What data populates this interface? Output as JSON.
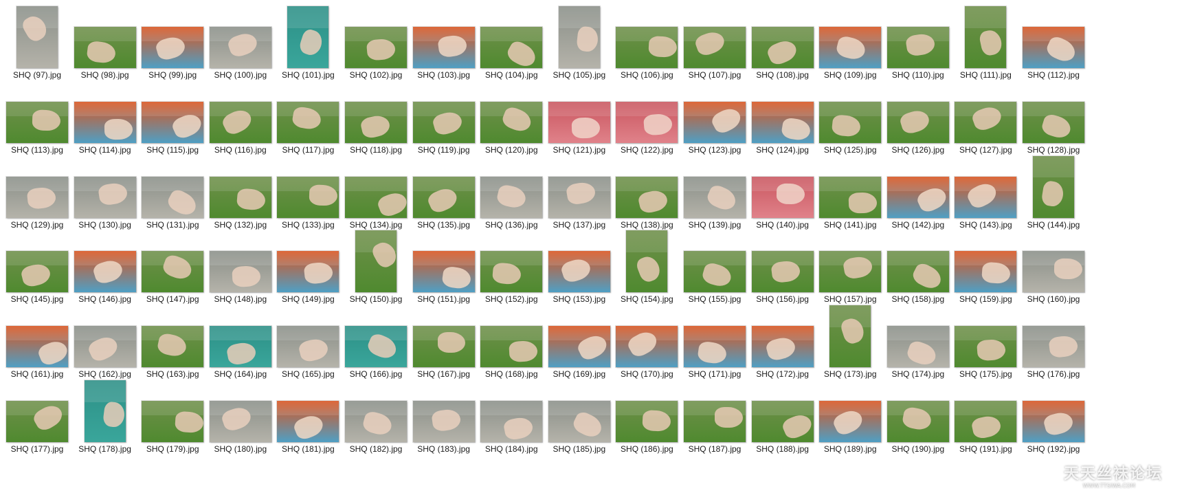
{
  "files": [
    {
      "name": "SHQ (97).jpg",
      "orientation": "portrait",
      "scene": "stone"
    },
    {
      "name": "SHQ (98).jpg",
      "orientation": "landscape",
      "scene": "grass"
    },
    {
      "name": "SHQ (99).jpg",
      "orientation": "landscape",
      "scene": "playground"
    },
    {
      "name": "SHQ (100).jpg",
      "orientation": "landscape",
      "scene": "stone"
    },
    {
      "name": "SHQ (101).jpg",
      "orientation": "portrait",
      "scene": "slide"
    },
    {
      "name": "SHQ (102).jpg",
      "orientation": "landscape",
      "scene": "grass"
    },
    {
      "name": "SHQ (103).jpg",
      "orientation": "landscape",
      "scene": "playground"
    },
    {
      "name": "SHQ (104).jpg",
      "orientation": "landscape",
      "scene": "grass"
    },
    {
      "name": "SHQ (105).jpg",
      "orientation": "portrait",
      "scene": "stone"
    },
    {
      "name": "SHQ (106).jpg",
      "orientation": "landscape",
      "scene": "grass"
    },
    {
      "name": "SHQ (107).jpg",
      "orientation": "landscape",
      "scene": "grass"
    },
    {
      "name": "SHQ (108).jpg",
      "orientation": "landscape",
      "scene": "grass"
    },
    {
      "name": "SHQ (109).jpg",
      "orientation": "landscape",
      "scene": "playground"
    },
    {
      "name": "SHQ (110).jpg",
      "orientation": "landscape",
      "scene": "grass"
    },
    {
      "name": "SHQ (111).jpg",
      "orientation": "portrait",
      "scene": "grass"
    },
    {
      "name": "SHQ (112).jpg",
      "orientation": "landscape",
      "scene": "playground"
    },
    {
      "name": "SHQ (113).jpg",
      "orientation": "landscape",
      "scene": "grass"
    },
    {
      "name": "SHQ (114).jpg",
      "orientation": "landscape",
      "scene": "playground"
    },
    {
      "name": "SHQ (115).jpg",
      "orientation": "landscape",
      "scene": "playground"
    },
    {
      "name": "SHQ (116).jpg",
      "orientation": "landscape",
      "scene": "grass"
    },
    {
      "name": "SHQ (117).jpg",
      "orientation": "landscape",
      "scene": "grass"
    },
    {
      "name": "SHQ (118).jpg",
      "orientation": "landscape",
      "scene": "grass"
    },
    {
      "name": "SHQ (119).jpg",
      "orientation": "landscape",
      "scene": "grass"
    },
    {
      "name": "SHQ (120).jpg",
      "orientation": "landscape",
      "scene": "grass"
    },
    {
      "name": "SHQ (121).jpg",
      "orientation": "landscape",
      "scene": "pinkslide"
    },
    {
      "name": "SHQ (122).jpg",
      "orientation": "landscape",
      "scene": "pinkslide"
    },
    {
      "name": "SHQ (123).jpg",
      "orientation": "landscape",
      "scene": "playground"
    },
    {
      "name": "SHQ (124).jpg",
      "orientation": "landscape",
      "scene": "playground"
    },
    {
      "name": "SHQ (125).jpg",
      "orientation": "landscape",
      "scene": "grass"
    },
    {
      "name": "SHQ (126).jpg",
      "orientation": "landscape",
      "scene": "grass"
    },
    {
      "name": "SHQ (127).jpg",
      "orientation": "landscape",
      "scene": "grass"
    },
    {
      "name": "SHQ (128).jpg",
      "orientation": "landscape",
      "scene": "grass"
    },
    {
      "name": "SHQ (129).jpg",
      "orientation": "landscape",
      "scene": "stone"
    },
    {
      "name": "SHQ (130).jpg",
      "orientation": "landscape",
      "scene": "stone"
    },
    {
      "name": "SHQ (131).jpg",
      "orientation": "landscape",
      "scene": "stone"
    },
    {
      "name": "SHQ (132).jpg",
      "orientation": "landscape",
      "scene": "grass"
    },
    {
      "name": "SHQ (133).jpg",
      "orientation": "landscape",
      "scene": "grass"
    },
    {
      "name": "SHQ (134).jpg",
      "orientation": "landscape",
      "scene": "grass"
    },
    {
      "name": "SHQ (135).jpg",
      "orientation": "landscape",
      "scene": "grass"
    },
    {
      "name": "SHQ (136).jpg",
      "orientation": "landscape",
      "scene": "stone"
    },
    {
      "name": "SHQ (137).jpg",
      "orientation": "landscape",
      "scene": "stone"
    },
    {
      "name": "SHQ (138).jpg",
      "orientation": "landscape",
      "scene": "grass"
    },
    {
      "name": "SHQ (139).jpg",
      "orientation": "landscape",
      "scene": "stone"
    },
    {
      "name": "SHQ (140).jpg",
      "orientation": "landscape",
      "scene": "pinkslide"
    },
    {
      "name": "SHQ (141).jpg",
      "orientation": "landscape",
      "scene": "grass"
    },
    {
      "name": "SHQ (142).jpg",
      "orientation": "landscape",
      "scene": "playground"
    },
    {
      "name": "SHQ (143).jpg",
      "orientation": "landscape",
      "scene": "playground"
    },
    {
      "name": "SHQ (144).jpg",
      "orientation": "portrait",
      "scene": "grass"
    },
    {
      "name": "SHQ (145).jpg",
      "orientation": "landscape",
      "scene": "grass"
    },
    {
      "name": "SHQ (146).jpg",
      "orientation": "landscape",
      "scene": "playground"
    },
    {
      "name": "SHQ (147).jpg",
      "orientation": "landscape",
      "scene": "grass"
    },
    {
      "name": "SHQ (148).jpg",
      "orientation": "landscape",
      "scene": "stone"
    },
    {
      "name": "SHQ (149).jpg",
      "orientation": "landscape",
      "scene": "playground"
    },
    {
      "name": "SHQ (150).jpg",
      "orientation": "portrait",
      "scene": "grass"
    },
    {
      "name": "SHQ (151).jpg",
      "orientation": "landscape",
      "scene": "playground"
    },
    {
      "name": "SHQ (152).jpg",
      "orientation": "landscape",
      "scene": "grass"
    },
    {
      "name": "SHQ (153).jpg",
      "orientation": "landscape",
      "scene": "playground"
    },
    {
      "name": "SHQ (154).jpg",
      "orientation": "portrait",
      "scene": "grass"
    },
    {
      "name": "SHQ (155).jpg",
      "orientation": "landscape",
      "scene": "grass"
    },
    {
      "name": "SHQ (156).jpg",
      "orientation": "landscape",
      "scene": "grass"
    },
    {
      "name": "SHQ (157).jpg",
      "orientation": "landscape",
      "scene": "grass"
    },
    {
      "name": "SHQ (158).jpg",
      "orientation": "landscape",
      "scene": "grass"
    },
    {
      "name": "SHQ (159).jpg",
      "orientation": "landscape",
      "scene": "playground"
    },
    {
      "name": "SHQ (160).jpg",
      "orientation": "landscape",
      "scene": "stone"
    },
    {
      "name": "SHQ (161).jpg",
      "orientation": "landscape",
      "scene": "playground"
    },
    {
      "name": "SHQ (162).jpg",
      "orientation": "landscape",
      "scene": "stone"
    },
    {
      "name": "SHQ (163).jpg",
      "orientation": "landscape",
      "scene": "grass"
    },
    {
      "name": "SHQ (164).jpg",
      "orientation": "landscape",
      "scene": "slide"
    },
    {
      "name": "SHQ (165).jpg",
      "orientation": "landscape",
      "scene": "stone"
    },
    {
      "name": "SHQ (166).jpg",
      "orientation": "landscape",
      "scene": "slide"
    },
    {
      "name": "SHQ (167).jpg",
      "orientation": "landscape",
      "scene": "grass"
    },
    {
      "name": "SHQ (168).jpg",
      "orientation": "landscape",
      "scene": "grass"
    },
    {
      "name": "SHQ (169).jpg",
      "orientation": "landscape",
      "scene": "playground"
    },
    {
      "name": "SHQ (170).jpg",
      "orientation": "landscape",
      "scene": "playground"
    },
    {
      "name": "SHQ (171).jpg",
      "orientation": "landscape",
      "scene": "playground"
    },
    {
      "name": "SHQ (172).jpg",
      "orientation": "landscape",
      "scene": "playground"
    },
    {
      "name": "SHQ (173).jpg",
      "orientation": "portrait",
      "scene": "grass"
    },
    {
      "name": "SHQ (174).jpg",
      "orientation": "landscape",
      "scene": "stone"
    },
    {
      "name": "SHQ (175).jpg",
      "orientation": "landscape",
      "scene": "grass"
    },
    {
      "name": "SHQ (176).jpg",
      "orientation": "landscape",
      "scene": "stone"
    },
    {
      "name": "SHQ (177).jpg",
      "orientation": "landscape",
      "scene": "grass"
    },
    {
      "name": "SHQ (178).jpg",
      "orientation": "portrait",
      "scene": "slide"
    },
    {
      "name": "SHQ (179).jpg",
      "orientation": "landscape",
      "scene": "grass"
    },
    {
      "name": "SHQ (180).jpg",
      "orientation": "landscape",
      "scene": "stone"
    },
    {
      "name": "SHQ (181).jpg",
      "orientation": "landscape",
      "scene": "playground"
    },
    {
      "name": "SHQ (182).jpg",
      "orientation": "landscape",
      "scene": "stone"
    },
    {
      "name": "SHQ (183).jpg",
      "orientation": "landscape",
      "scene": "stone"
    },
    {
      "name": "SHQ (184).jpg",
      "orientation": "landscape",
      "scene": "stone"
    },
    {
      "name": "SHQ (185).jpg",
      "orientation": "landscape",
      "scene": "stone"
    },
    {
      "name": "SHQ (186).jpg",
      "orientation": "landscape",
      "scene": "grass"
    },
    {
      "name": "SHQ (187).jpg",
      "orientation": "landscape",
      "scene": "grass"
    },
    {
      "name": "SHQ (188).jpg",
      "orientation": "landscape",
      "scene": "grass"
    },
    {
      "name": "SHQ (189).jpg",
      "orientation": "landscape",
      "scene": "playground"
    },
    {
      "name": "SHQ (190).jpg",
      "orientation": "landscape",
      "scene": "grass"
    },
    {
      "name": "SHQ (191).jpg",
      "orientation": "landscape",
      "scene": "grass"
    },
    {
      "name": "SHQ (192).jpg",
      "orientation": "landscape",
      "scene": "playground"
    }
  ],
  "scene_palettes": {
    "grass": {
      "top": "#6f8f4a",
      "bottom": "#4f8a2f",
      "blob": "#e6c9b4"
    },
    "stone": {
      "top": "#8a8f88",
      "bottom": "#b5b3aa",
      "blob": "#e9d0be"
    },
    "playground": {
      "top": "#d9531e",
      "bottom": "#4f9fc4",
      "blob": "#eed8c6"
    },
    "slide": {
      "top": "#2c8f86",
      "bottom": "#3aa69b",
      "blob": "#e9cdb8"
    },
    "pinkslide": {
      "top": "#c9565f",
      "bottom": "#e0828a",
      "blob": "#f0d5c9"
    }
  },
  "watermark": {
    "text": "天天丝袜论坛",
    "url": "WWW.TTSIWA.COM"
  }
}
